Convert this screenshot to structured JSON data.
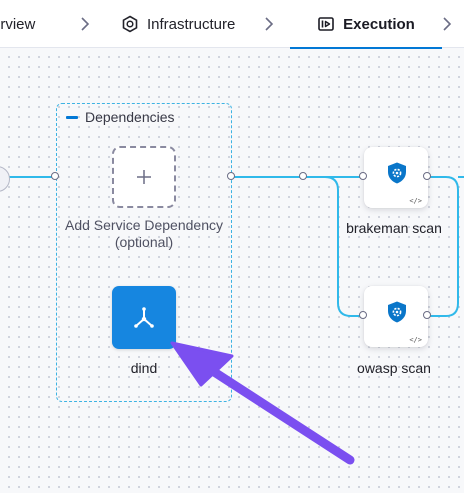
{
  "nav": {
    "tabs": [
      {
        "label": "erview",
        "icon": "none"
      },
      {
        "label": "Infrastructure",
        "icon": "hexagon-icon"
      },
      {
        "label": "Execution",
        "icon": "execution-icon",
        "active": true
      }
    ]
  },
  "pipeline": {
    "dependencies": {
      "header": "Dependencies",
      "add_label": "Add Service Dependency (optional)",
      "service": {
        "label": "dind",
        "icon": "docker-hub-icon"
      }
    },
    "steps": [
      {
        "label": "brakeman scan",
        "icon": "security-shield-icon"
      },
      {
        "label": "owasp scan",
        "icon": "security-shield-icon"
      }
    ],
    "code_badge": "</>"
  },
  "colors": {
    "accent": "#0278d5",
    "wire": "#30b9ea",
    "dind_bg": "#1686e0",
    "arrow": "#7b4ff0",
    "dashed_box": "#3db3e3"
  }
}
